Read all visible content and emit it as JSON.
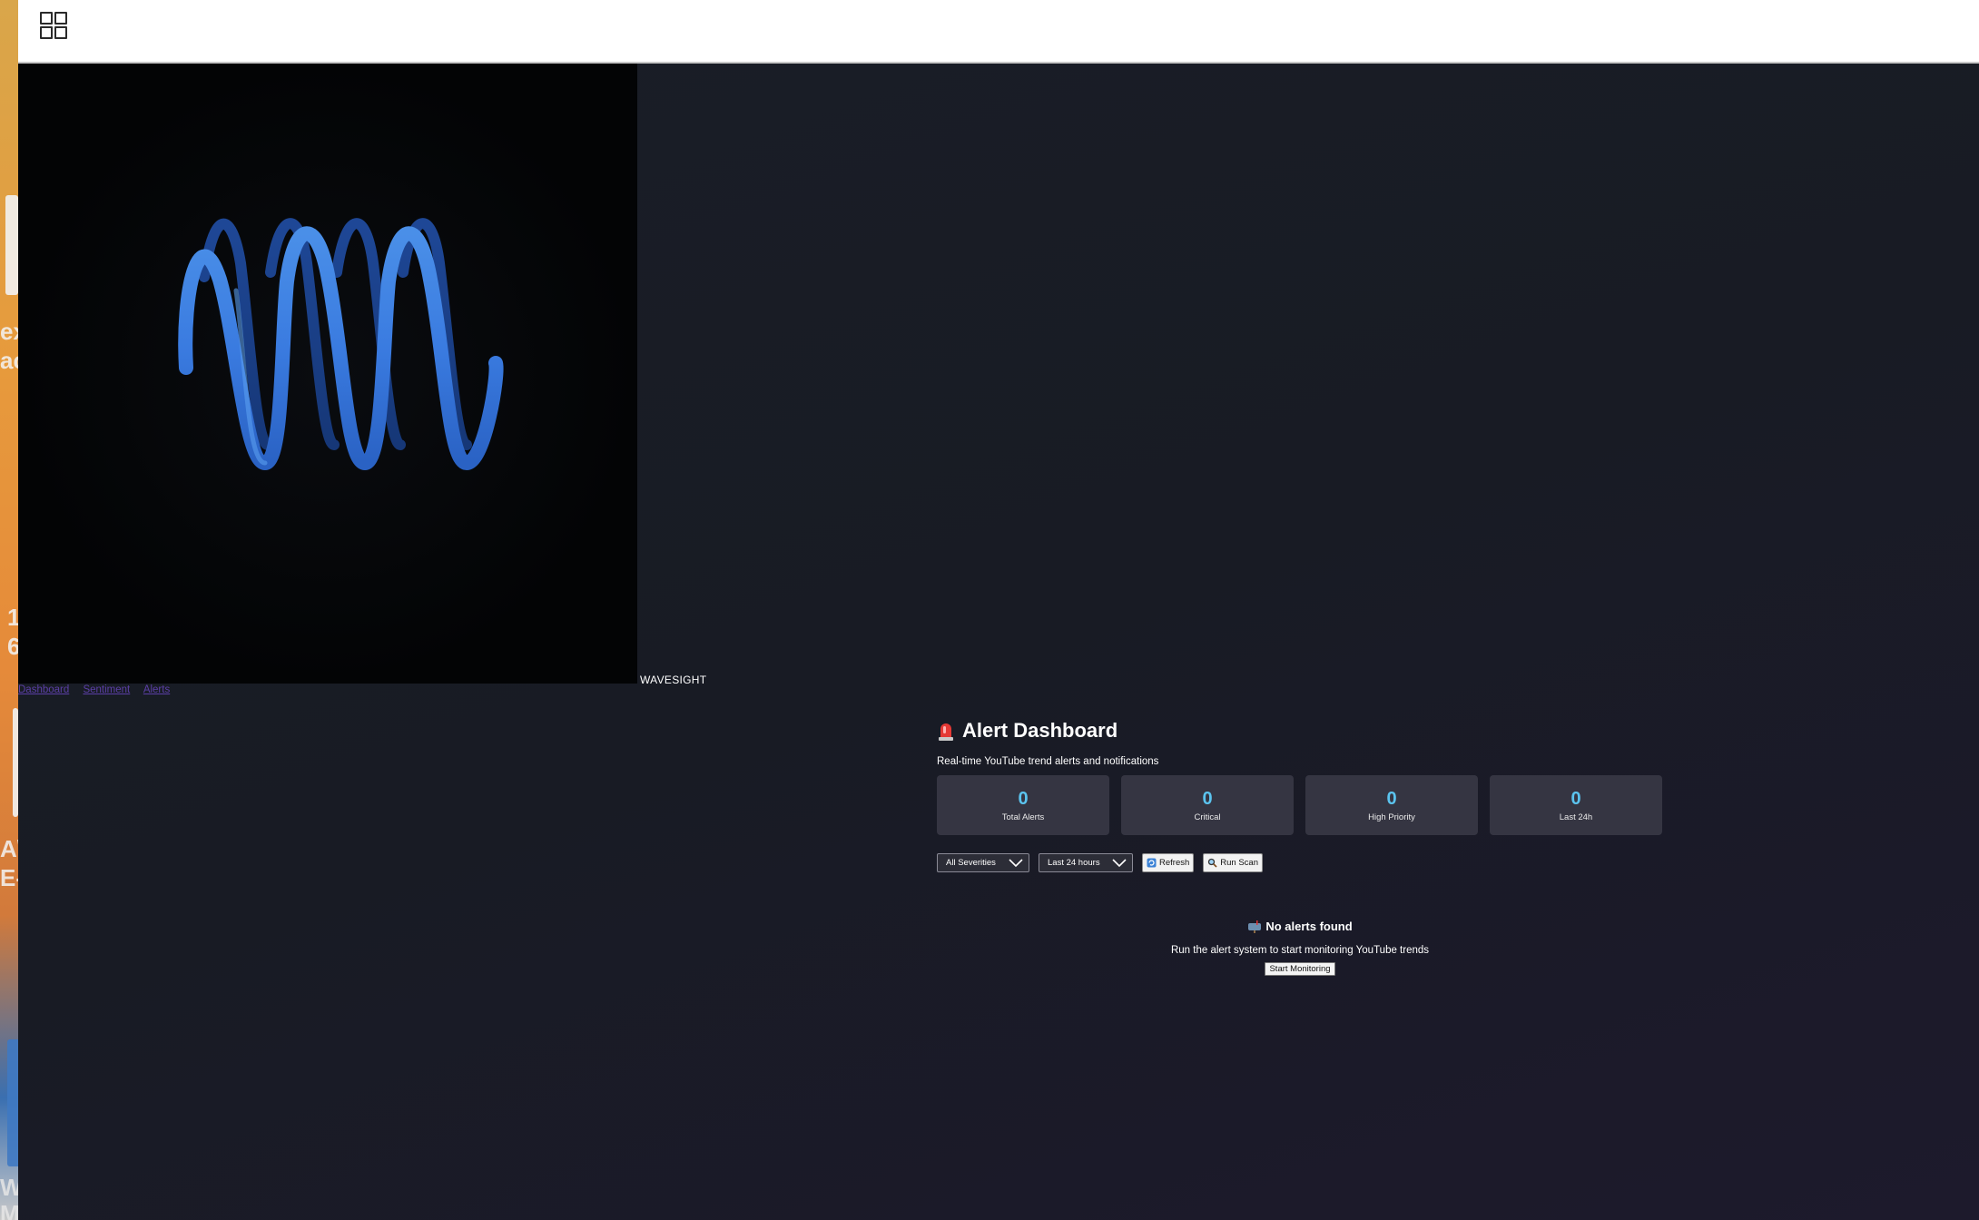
{
  "desktop": {
    "fragments": [
      "ex",
      "ac",
      "1",
      "6",
      "A\\",
      "E-",
      "W",
      "M"
    ]
  },
  "topbar": {
    "menu_icon": "grid-icon"
  },
  "hero": {
    "graphic": "blue-helix-spiral",
    "brand": "WAVESIGHT"
  },
  "nav": {
    "links": [
      "Dashboard",
      "Sentiment",
      "Alerts"
    ]
  },
  "dashboard": {
    "icon": "siren-icon",
    "title": "Alert Dashboard",
    "subtitle": "Real-time YouTube trend alerts and notifications",
    "stats": [
      {
        "value": "0",
        "label": "Total Alerts"
      },
      {
        "value": "0",
        "label": "Critical"
      },
      {
        "value": "0",
        "label": "High Priority"
      },
      {
        "value": "0",
        "label": "Last 24h"
      }
    ],
    "filters": {
      "severity": "All Severities",
      "timeframe": "Last 24 hours"
    },
    "buttons": {
      "refresh": "Refresh",
      "scan": "Run Scan"
    },
    "empty": {
      "icon": "mailbox-icon",
      "title": "No alerts found",
      "message": "Run the alert system to start monitoring YouTube trends",
      "action": "Start Monitoring"
    }
  },
  "colors": {
    "accent": "#5bc4ef",
    "card": "#353542",
    "background": "#1a1e27",
    "link": "#5b3fa6"
  }
}
